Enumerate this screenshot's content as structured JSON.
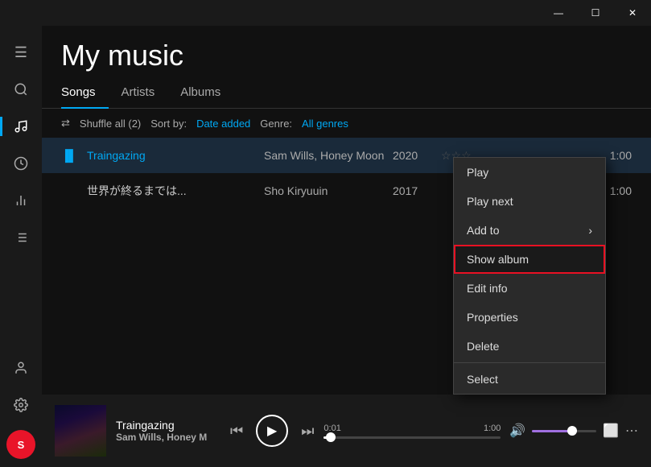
{
  "titlebar": {
    "minimize_label": "—",
    "maximize_label": "☐",
    "close_label": "✕"
  },
  "sidebar": {
    "icons": [
      {
        "name": "menu-icon",
        "symbol": "≡",
        "active": false
      },
      {
        "name": "search-icon",
        "symbol": "🔍",
        "active": false
      },
      {
        "name": "music-note-icon",
        "symbol": "♪",
        "active": true
      },
      {
        "name": "recent-icon",
        "symbol": "🕐",
        "active": false
      },
      {
        "name": "bar-chart-icon",
        "symbol": "📊",
        "active": false
      },
      {
        "name": "list-icon",
        "symbol": "≡",
        "active": false
      }
    ],
    "bottom_icons": [
      {
        "name": "user-icon",
        "symbol": "👤"
      },
      {
        "name": "settings-icon",
        "symbol": "⚙"
      }
    ],
    "spotify_label": "S"
  },
  "page": {
    "title": "My music",
    "tabs": [
      {
        "label": "Songs",
        "active": true
      },
      {
        "label": "Artists",
        "active": false
      },
      {
        "label": "Albums",
        "active": false
      }
    ],
    "toolbar": {
      "shuffle_label": "Shuffle all (2)",
      "sort_label": "Sort by:",
      "sort_value": "Date added",
      "genre_label": "Genre:",
      "genre_value": "All genres"
    },
    "songs": [
      {
        "playing": true,
        "icon": "▐",
        "title": "Traingazing",
        "artist": "Sam Wills, Honey Moon",
        "year": "2020",
        "rating": "☆☆☆",
        "duration": "1:00"
      },
      {
        "playing": false,
        "icon": "",
        "title": "世界が終るまでは...",
        "artist": "Sho Kiryuuin",
        "year": "2017",
        "rating": "",
        "duration": "1:00"
      }
    ]
  },
  "context_menu": {
    "items": [
      {
        "label": "Play",
        "highlighted": false,
        "has_arrow": false
      },
      {
        "label": "Play next",
        "highlighted": false,
        "has_arrow": false
      },
      {
        "label": "Add to",
        "highlighted": false,
        "has_arrow": true
      },
      {
        "label": "Show album",
        "highlighted": true,
        "has_arrow": false
      },
      {
        "label": "Edit info",
        "highlighted": false,
        "has_arrow": false
      },
      {
        "label": "Properties",
        "highlighted": false,
        "has_arrow": false
      },
      {
        "label": "Delete",
        "highlighted": false,
        "has_arrow": false
      },
      {
        "label": "Select",
        "highlighted": false,
        "has_arrow": false
      }
    ]
  },
  "now_playing": {
    "title": "Traingazing",
    "artist": "Sam Wills, Honey M",
    "time_current": "0:01",
    "time_total": "1:00",
    "progress_pct": 4,
    "volume_pct": 70
  }
}
